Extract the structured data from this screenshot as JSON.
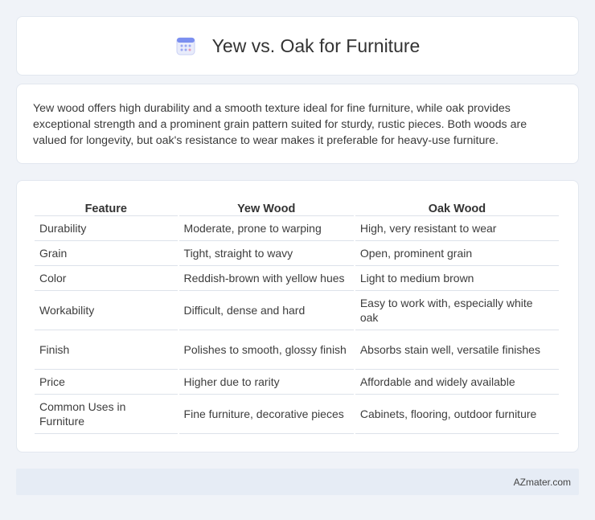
{
  "header": {
    "title": "Yew vs. Oak for Furniture",
    "icon": "calendar-icon",
    "icon_color": "#7b8ff0"
  },
  "summary": {
    "text": "Yew wood offers high durability and a smooth texture ideal for fine furniture, while oak provides exceptional strength and a prominent grain pattern suited for sturdy, rustic pieces. Both woods are valued for longevity, but oak's resistance to wear makes it preferable for heavy-use furniture."
  },
  "table": {
    "headers": [
      "Feature",
      "Yew Wood",
      "Oak Wood"
    ],
    "rows": [
      [
        "Durability",
        "Moderate, prone to warping",
        "High, very resistant to wear"
      ],
      [
        "Grain",
        "Tight, straight to wavy",
        "Open, prominent grain"
      ],
      [
        "Color",
        "Reddish-brown with yellow hues",
        "Light to medium brown"
      ],
      [
        "Workability",
        "Difficult, dense and hard",
        "Easy to work with, especially white oak"
      ],
      [
        "Finish",
        "Polishes to smooth, glossy finish",
        "Absorbs stain well, versatile finishes"
      ],
      [
        "Price",
        "Higher due to rarity",
        "Affordable and widely available"
      ],
      [
        "Common Uses in Furniture",
        "Fine furniture, decorative pieces",
        "Cabinets, flooring, outdoor furniture"
      ]
    ]
  },
  "footer": {
    "text": "AZmater.com"
  }
}
